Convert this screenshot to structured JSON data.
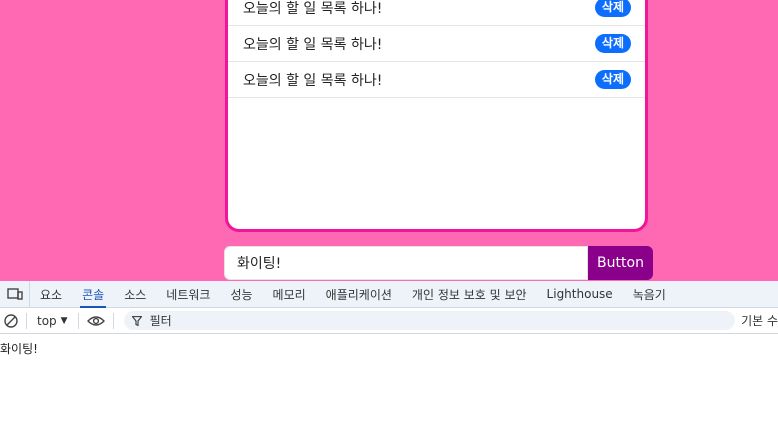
{
  "todo": {
    "items": [
      {
        "text": "오늘의 할 일 목록 하나!",
        "delete_label": "삭제"
      },
      {
        "text": "오늘의 할 일 목록 하나!",
        "delete_label": "삭제"
      },
      {
        "text": "오늘의 할 일 목록 하나!",
        "delete_label": "삭제"
      }
    ],
    "input_value": "화이팅!",
    "add_button_label": "Button"
  },
  "colors": {
    "page_bg": "#ff69b4",
    "card_border": "#f0169a",
    "delete_btn": "#0d6efd",
    "add_btn": "#8b008b"
  },
  "devtools": {
    "tabs": [
      "요소",
      "콘솔",
      "소스",
      "네트워크",
      "성능",
      "메모리",
      "애플리케이션",
      "개인 정보 보호 및 보안",
      "Lighthouse",
      "녹음기"
    ],
    "active_tab": "콘솔",
    "context": "top",
    "filter_placeholder": "필터",
    "levels_label": "기본 수",
    "console_output": "화이팅!"
  }
}
